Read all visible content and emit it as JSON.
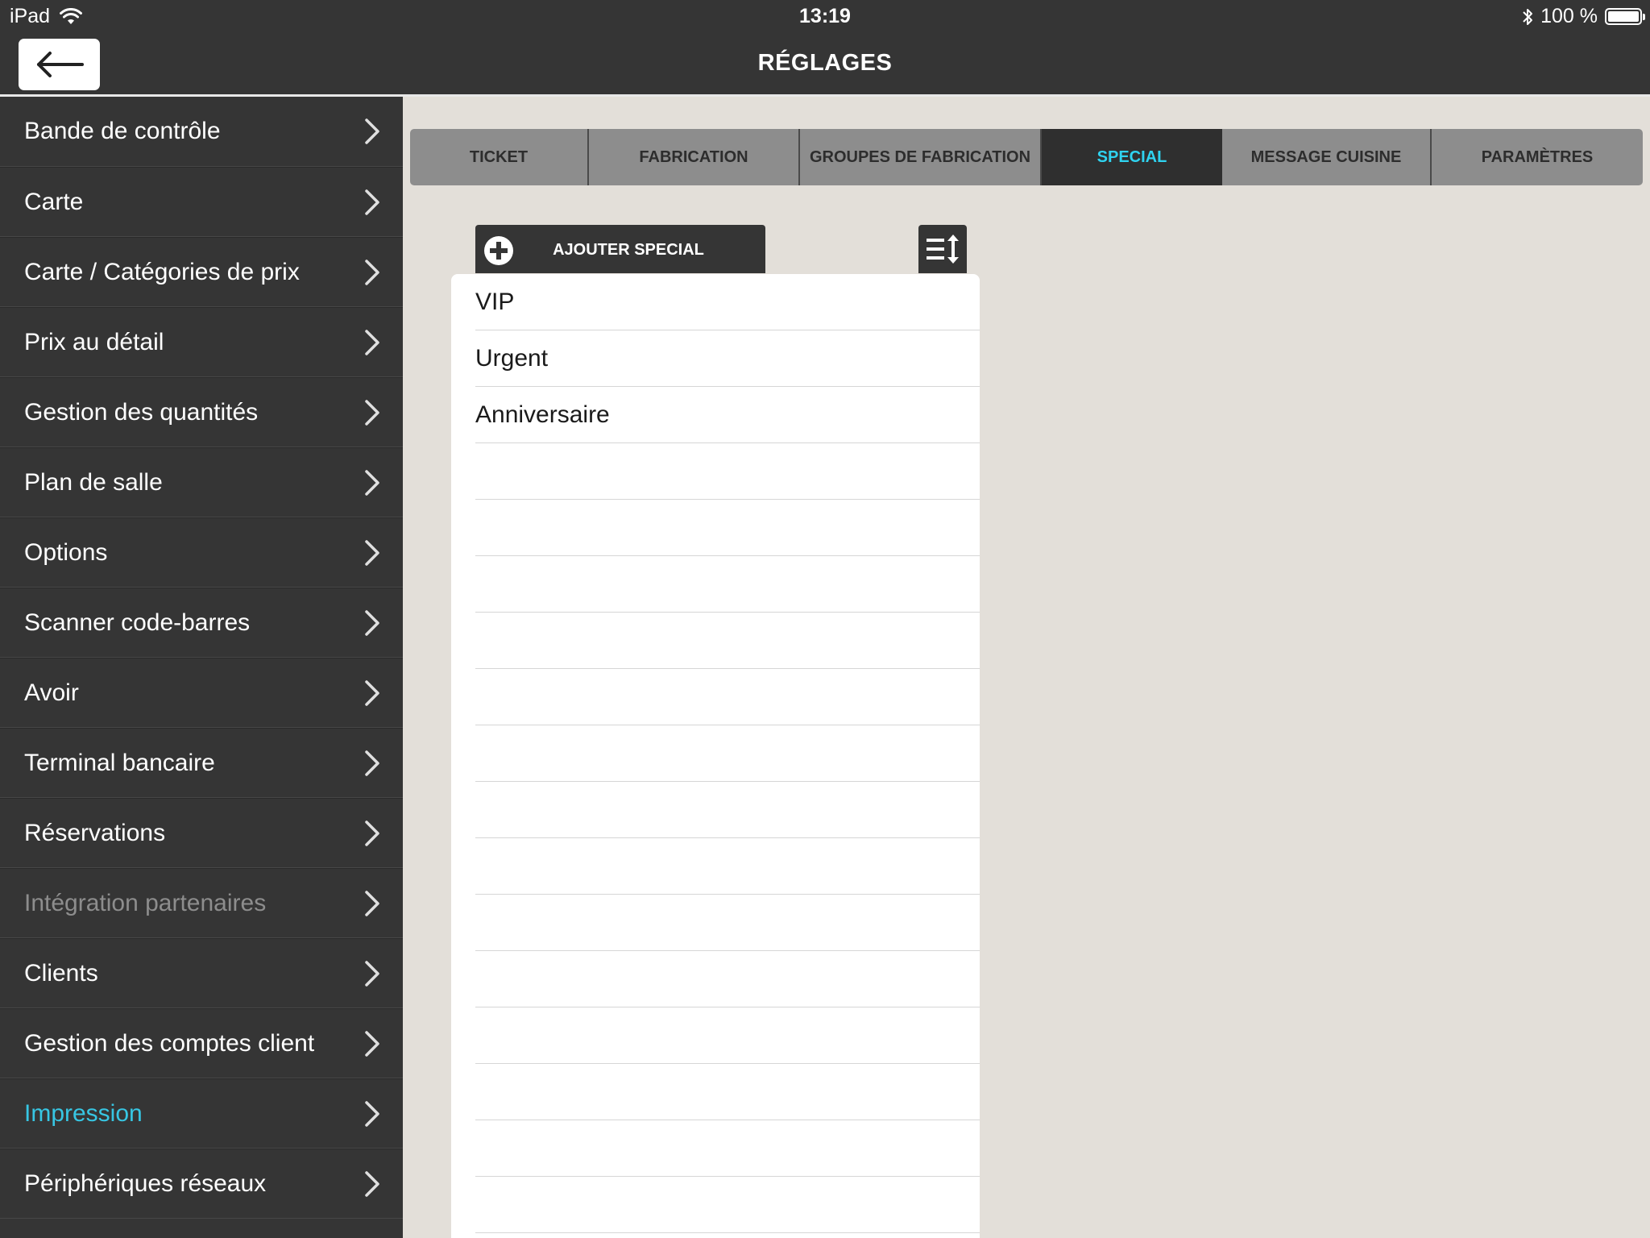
{
  "status_bar": {
    "device": "iPad",
    "time": "13:19",
    "battery": "100 %",
    "battery_level": 1.0
  },
  "header": {
    "title": "RÉGLAGES",
    "back_icon": "arrow-left-icon"
  },
  "sidebar": {
    "items": [
      {
        "label": "Bande de contrôle",
        "state": "normal"
      },
      {
        "label": "Carte",
        "state": "normal"
      },
      {
        "label": "Carte / Catégories de prix",
        "state": "normal"
      },
      {
        "label": "Prix au détail",
        "state": "normal"
      },
      {
        "label": "Gestion des quantités",
        "state": "normal"
      },
      {
        "label": "Plan de salle",
        "state": "normal"
      },
      {
        "label": "Options",
        "state": "normal"
      },
      {
        "label": "Scanner code-barres",
        "state": "normal"
      },
      {
        "label": "Avoir",
        "state": "normal"
      },
      {
        "label": "Terminal bancaire",
        "state": "normal"
      },
      {
        "label": "Réservations",
        "state": "normal"
      },
      {
        "label": "Intégration partenaires",
        "state": "disabled"
      },
      {
        "label": "Clients",
        "state": "normal"
      },
      {
        "label": "Gestion des comptes client",
        "state": "normal"
      },
      {
        "label": "Impression",
        "state": "active"
      },
      {
        "label": "Périphériques réseaux",
        "state": "normal"
      }
    ]
  },
  "tabs": [
    {
      "label": "TICKET",
      "active": false
    },
    {
      "label": "FABRICATION",
      "active": false
    },
    {
      "label": "GROUPES DE FABRICATION",
      "active": false
    },
    {
      "label": "SPECIAL",
      "active": true
    },
    {
      "label": "MESSAGE CUISINE",
      "active": false
    },
    {
      "label": "PARAMÈTRES",
      "active": false
    }
  ],
  "special": {
    "add_label": "AJOUTER SPECIAL",
    "add_icon": "plus-circle-icon",
    "sort_icon": "sort-icon",
    "items": [
      "VIP",
      "Urgent",
      "Anniversaire",
      "",
      "",
      "",
      "",
      "",
      "",
      "",
      "",
      "",
      "",
      "",
      "",
      "",
      ""
    ]
  },
  "colors": {
    "accent": "#37c6e3",
    "header_bg": "#353535",
    "content_bg": "#e3dfd9",
    "tab_bg": "#8d8d8d",
    "tab_active_bg": "#2f2f2f"
  }
}
